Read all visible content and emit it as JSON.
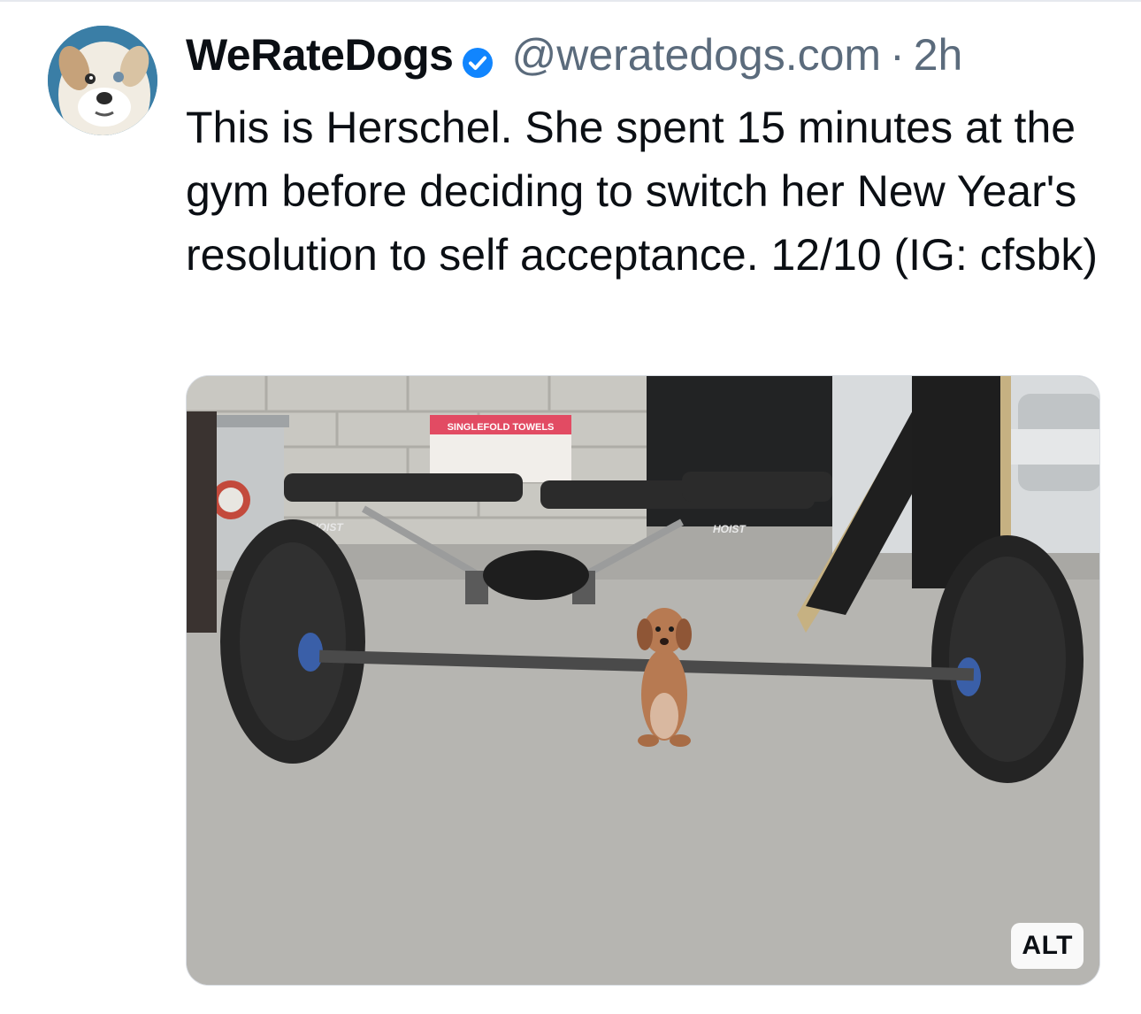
{
  "post": {
    "display_name": "WeRateDogs",
    "verified": true,
    "handle": "@weratedogs.com",
    "separator": "·",
    "time": "2h",
    "avatar_icon": "dog-avatar",
    "text": "This is Herschel. She spent 15 minutes at the gym before deciding to switch her New Year's resolution to self acceptance. 12/10 (IG: cfsbk)"
  },
  "media": {
    "alt_label": "ALT",
    "box_label": "SINGLEFOLD TOWELS",
    "bench_brand": "HOIST"
  },
  "colors": {
    "text": "#0b0f14",
    "secondary": "#5b6b7c",
    "verified": "#1185fe"
  }
}
